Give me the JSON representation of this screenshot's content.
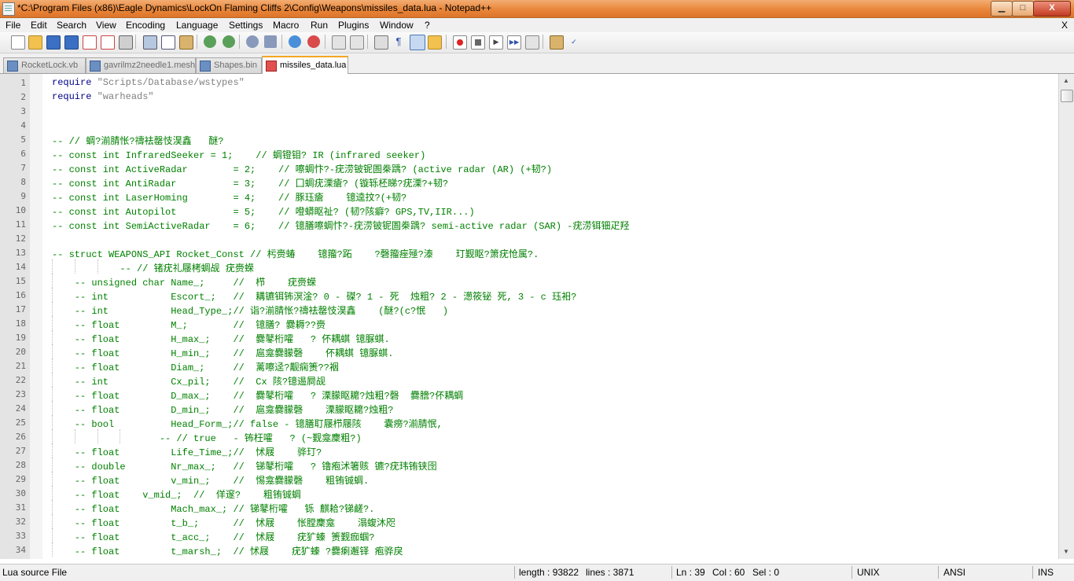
{
  "window": {
    "title": "*C:\\Program Files (x86)\\Eagle Dynamics\\LockOn Flaming Cliffs 2\\Config\\Weapons\\missiles_data.lua - Notepad++",
    "minimize_label": "▁",
    "maximize_label": "□",
    "close_label": "X"
  },
  "menu": {
    "items": [
      "File",
      "Edit",
      "Search",
      "View",
      "Encoding",
      "Language",
      "Settings",
      "Macro",
      "Run",
      "Plugins",
      "Window",
      "?"
    ],
    "close_doc": "X"
  },
  "toolbar": {
    "icons": [
      "new-file-icon",
      "open-file-icon",
      "save-icon",
      "save-all-icon",
      "close-icon",
      "close-all-icon",
      "print-icon",
      "cut-icon",
      "copy-icon",
      "paste-icon",
      "undo-icon",
      "redo-icon",
      "find-icon",
      "replace-icon",
      "zoom-in-icon",
      "zoom-out-icon",
      "sync-v-icon",
      "sync-h-icon",
      "word-wrap-icon",
      "show-all-chars-icon",
      "indent-guide-icon",
      "doc-map-icon",
      "record-macro-icon",
      "stop-macro-icon",
      "play-macro-icon",
      "play-multiple-icon",
      "save-macro-icon",
      "launch-icon",
      "spellcheck-icon"
    ]
  },
  "tabs": [
    {
      "label": "RocketLock.vb",
      "active": false
    },
    {
      "label": "gavrilmz2needle1.mesh",
      "active": false
    },
    {
      "label": "Shapes.bin",
      "active": false
    },
    {
      "label": "missiles_data.lua",
      "active": true
    }
  ],
  "editor": {
    "lines": [
      {
        "n": "1",
        "text": "require \"Scripts/Database/wstypes\""
      },
      {
        "n": "2",
        "text": "require \"warheads\""
      },
      {
        "n": "3",
        "text": ""
      },
      {
        "n": "4",
        "text": ""
      },
      {
        "n": "5",
        "text": "-- // 蜩?湔腈怅?禱袪罄忮淏鑫   醚?"
      },
      {
        "n": "6",
        "text": "-- const int InfraredSeeker = 1;    // 蜩镫钼? IR (infrared seeker)"
      },
      {
        "n": "7",
        "text": "-- const int ActiveRadar        = 2;    // 嚓蜩忭?-疣涝铍铌圄桊踽? (active radar (AR) (+韧?)"
      },
      {
        "n": "8",
        "text": "-- const int AntiRadar          = 3;    // 囗蜩疣溧瘡? (镟轹柸睇?疣溧?+韧?"
      },
      {
        "n": "9",
        "text": "-- const int LaserHoming        = 4;    // 豚珏瘡    镱逵抆?(+韧?"
      },
      {
        "n": "10",
        "text": "-- const int Autopilot          = 5;    // 噔蟒眍祉? (韧?陔癖? GPS,TV,IIR...)"
      },
      {
        "n": "11",
        "text": "-- const int SemiActiveRadar    = 6;    // 镱膳嚓蜩忭?-疣涝铍铌圄桊踽? semi-active radar (SAR) -疣涝铒钿疋羟"
      },
      {
        "n": "12",
        "text": ""
      },
      {
        "n": "13",
        "text": "-- struct WEAPONS_API Rocket_Const // 杇赍蝽    镱籀?跖    ?磬籀痤殛?溙    玎觐眍?箫疣怆属?."
      },
      {
        "n": "14",
        "text": "            -- // 锗疣礼屦栲蜩觇 疣赍蝾"
      },
      {
        "n": "15",
        "text": "    -- unsigned char Name_;     //  栉    疣赍蝾"
      },
      {
        "n": "16",
        "text": "    -- int           Escort_;   //  耩镳铒钸溟淦? 0 - 磔? 1 - 死  烛粗? 2 - 濍筱铋 死, 3 - c 珏衵?"
      },
      {
        "n": "17",
        "text": "    -- int           Head_Type_;// 诣?湔腈怅?禱袪罄忮淏鑫    (醚?(c?怋   )"
      },
      {
        "n": "18",
        "text": "    -- float         M_;        //  镱膳? 爨耨??赍"
      },
      {
        "n": "19",
        "text": "    -- float         H_max_;    //  爨鼕桁嚯   ? 伓耦蜞 镱脲蜞."
      },
      {
        "n": "20",
        "text": "    -- float         H_min_;    //  扈龛爨朦磬    伓耦蜞 镱脲蜞."
      },
      {
        "n": "21",
        "text": "    -- float         Diam_;     //  蓠嚓迳?觏痫箦??裀"
      },
      {
        "n": "22",
        "text": "    -- int           Cx_pil;    //  Cx 陔?镱逷屙觇"
      },
      {
        "n": "23",
        "text": "    -- float         D_max_;    //  爨鼕桁嚯   ? 溧朦眍耱?烛粗?磬  爨膪?伓耦蜩"
      },
      {
        "n": "24",
        "text": "    -- float         D_min_;    //  扈龛爨朦磬    溧朦眍耱?烛粗?"
      },
      {
        "n": "25",
        "text": "    -- bool          Head_Form_;// false - 镱膳耵屦栉屦陔    囊痨?湔腈怋,"
      },
      {
        "n": "26",
        "text": "                   -- // true   - 钸枉嚯   ? (~觐龛麇粗?)"
      },
      {
        "n": "27",
        "text": "    -- float         Life_Time_;//  怵屐    骅玎?"
      },
      {
        "n": "28",
        "text": "    -- double        Nr_max_;   //  锑鼕桁嚯   ? 镥疱沭箸赅 镳?疣玮铕铗囹"
      },
      {
        "n": "29",
        "text": "    -- float         v_min_;    //  惕龛爨朦磬    粗铕铖蜩."
      },
      {
        "n": "30",
        "text": "    -- float    v_mid_;  //  佯邃?    粗铕铖蜩"
      },
      {
        "n": "31",
        "text": "    -- float         Mach_max_; // 锑鼕桁嚯   铄 麒耠?锑鹾?."
      },
      {
        "n": "32",
        "text": "    -- float         t_b_;      //  怵屐    怅膛麇龛    溻蝮沐咫"
      },
      {
        "n": "33",
        "text": "    -- float         t_acc_;    //  怵屐    疣犷螓 箦觐痂蝈?"
      },
      {
        "n": "34",
        "text": "    -- float         t_marsh_;  // 怵屐    疣犷螓 ?爨瘌邂铎 疱骅戾"
      }
    ]
  },
  "statusbar": {
    "file_type": "Lua source File",
    "length": "length : 93822",
    "lines": "lines : 3871",
    "ln": "Ln : 39",
    "col": "Col : 60",
    "sel": "Sel : 0",
    "eol": "UNIX",
    "encoding": "ANSI",
    "mode": "INS"
  },
  "colors": {
    "titlebar": "#e9863a",
    "comment": "#008000",
    "keyword": "#00008b",
    "string": "#808080",
    "active_tab_accent": "#f5a623"
  }
}
